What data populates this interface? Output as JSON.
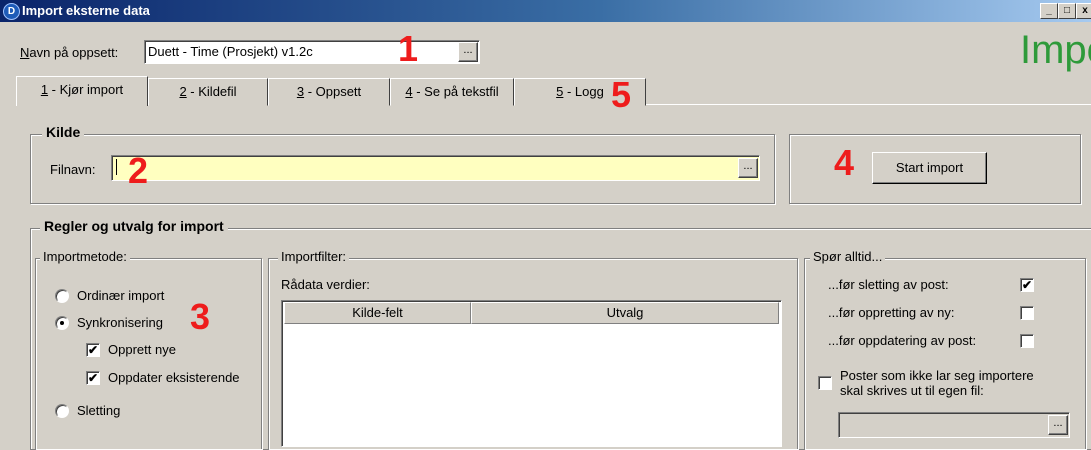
{
  "window": {
    "title": "Import eksterne data",
    "app_badge": "D",
    "btn_min": "_",
    "btn_max": "□",
    "btn_close": "x"
  },
  "setup": {
    "label_prefix": "N",
    "label_rest": "avn på oppsett:",
    "value": "Duett - Time (Prosjekt) v1.2c",
    "browse": "..."
  },
  "heading": "Import",
  "tabs": [
    {
      "key": "1",
      "rest": " - Kjør import"
    },
    {
      "key": "2",
      "rest": " - Kildefil"
    },
    {
      "key": "3",
      "rest": " - Oppsett"
    },
    {
      "key": "4",
      "rest": " - Se på tekstfil"
    },
    {
      "key": "5",
      "rest": " - Logg"
    }
  ],
  "source": {
    "group_title": "Kilde",
    "file_label": "Filnavn:",
    "file_value": "",
    "browse": "..."
  },
  "start_button": "Start import",
  "rules": {
    "group_title": "Regler og utvalg for import",
    "method_label": "Importmetode:",
    "options": [
      "Ordinær import",
      "Synkronisering",
      "Sletting"
    ],
    "selected": "Synkronisering",
    "sub_options": [
      {
        "label": "Opprett nye",
        "checked": true
      },
      {
        "label": "Oppdater eksisterende",
        "checked": true
      }
    ]
  },
  "filter": {
    "label": "Importfilter:",
    "raw_label": "Rådata verdier:",
    "columns": [
      "Kilde-felt",
      "Utvalg"
    ]
  },
  "ask": {
    "title": "Spør alltid...",
    "items": [
      {
        "label": "...før sletting av post:",
        "checked": true
      },
      {
        "label": "...før oppretting av ny:",
        "checked": false
      },
      {
        "label": "...før oppdatering av post:",
        "checked": false
      }
    ],
    "error_file_label_1": "Poster som ikke lar seg importere",
    "error_file_label_2": "skal skrives ut til egen fil:",
    "error_file_checked": false,
    "browse": "..."
  },
  "markers": [
    "1",
    "2",
    "3",
    "4",
    "5"
  ],
  "check_mark": "✔"
}
